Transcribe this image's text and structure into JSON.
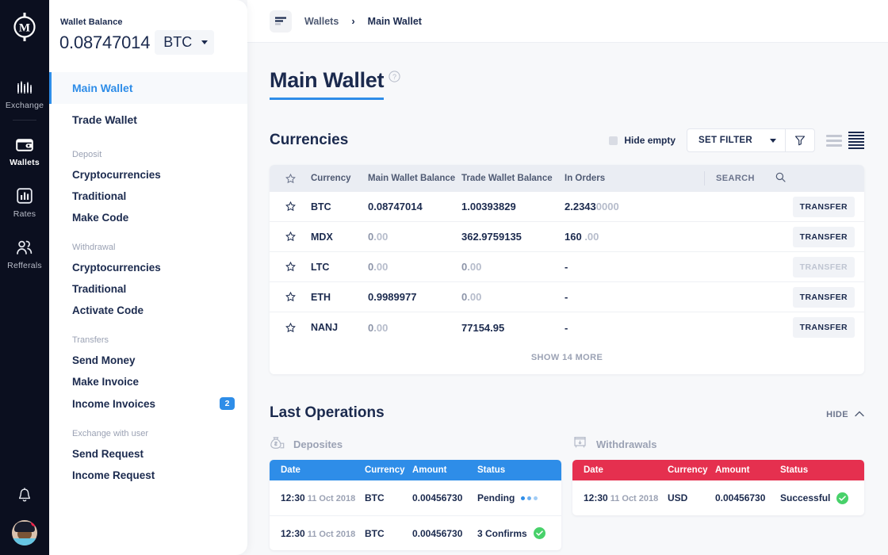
{
  "rail": {
    "logo_icon": "m-emblem-logo",
    "items": [
      {
        "label": "Exchange",
        "icon": "chart-bars-icon",
        "active": false
      },
      {
        "label": "Wallets",
        "icon": "wallet-icon",
        "active": true
      },
      {
        "label": "Rates",
        "icon": "bar-chart-square-icon",
        "active": false
      },
      {
        "label": "Refferals",
        "icon": "people-icon",
        "active": false
      }
    ],
    "bell_icon": "bell-icon",
    "avatar_alt": "user-avatar"
  },
  "panel": {
    "balance_label": "Wallet Balance",
    "balance_amount": "0.08747014",
    "balance_currency": "BTC",
    "nav_main": [
      {
        "label": "Main Wallet",
        "active": true
      },
      {
        "label": "Trade Wallet",
        "active": false
      }
    ],
    "groups": [
      {
        "title": "Deposit",
        "links": [
          {
            "label": "Cryptocurrencies",
            "badge": ""
          },
          {
            "label": "Traditional",
            "badge": ""
          },
          {
            "label": "Make Code",
            "badge": ""
          }
        ]
      },
      {
        "title": "Withdrawal",
        "links": [
          {
            "label": "Cryptocurrencies",
            "badge": ""
          },
          {
            "label": "Traditional",
            "badge": ""
          },
          {
            "label": "Activate Code",
            "badge": ""
          }
        ]
      },
      {
        "title": "Transfers",
        "links": [
          {
            "label": "Send Money",
            "badge": ""
          },
          {
            "label": "Make Invoice",
            "badge": ""
          },
          {
            "label": "Income Invoices",
            "badge": "2"
          }
        ]
      },
      {
        "title": "Exchange with user",
        "links": [
          {
            "label": "Send Request",
            "badge": ""
          },
          {
            "label": "Income Request",
            "badge": ""
          }
        ]
      }
    ]
  },
  "topbar": {
    "menu_icon": "hamburger-menu-icon",
    "breadcrumb": [
      "Wallets",
      "Main Wallet"
    ],
    "separator": "›"
  },
  "page": {
    "title": "Main Wallet",
    "help_icon": "question-circle-icon"
  },
  "currencies": {
    "section_title": "Currencies",
    "hide_empty_label": "Hide empty",
    "hide_empty_checked": false,
    "set_filter_label": "SET FILTER",
    "funnel_icon": "filter-funnel-icon",
    "view_icons": [
      "list-view-icon",
      "compact-view-icon"
    ],
    "columns": [
      "Currency",
      "Main Wallet Balance",
      "Trade Wallet Balance",
      "In Orders"
    ],
    "star_icon": "star-outline-icon",
    "search_label": "SEARCH",
    "search_icon": "magnifier-icon",
    "rows": [
      {
        "currency": "BTC",
        "main": "0.08747014",
        "main_dim": "",
        "trade": "1.00393829",
        "trade_dim": "",
        "orders": "2.2343",
        "orders_dim": "0000",
        "action": "TRANSFER",
        "action_enabled": true
      },
      {
        "currency": "MDX",
        "main": "0",
        "main_dim": ".00",
        "trade": "362.9759135",
        "trade_dim": "",
        "orders": "160 ",
        "orders_dim": ".00",
        "action": "TRANSFER",
        "action_enabled": true
      },
      {
        "currency": "LTC",
        "main": "0",
        "main_dim": ".00",
        "trade": "0",
        "trade_dim": ".00",
        "orders": "-",
        "orders_dim": "",
        "action": "TRANSFER",
        "action_enabled": false
      },
      {
        "currency": "ETH",
        "main": "0.9989977",
        "main_dim": "",
        "trade": "0",
        "trade_dim": ".00",
        "orders": "-",
        "orders_dim": "",
        "action": "TRANSFER",
        "action_enabled": true
      },
      {
        "currency": "NANJ",
        "main": "0",
        "main_dim": ".00",
        "trade": "77154.95",
        "trade_dim": "",
        "orders": "-",
        "orders_dim": "",
        "action": "TRANSFER",
        "action_enabled": true
      }
    ],
    "show_more": "SHOW 14 MORE"
  },
  "operations": {
    "section_title": "Last Operations",
    "hide_label": "HIDE",
    "collapse_icon": "chevron-up-icon",
    "deposits": {
      "caption": "Deposites",
      "icon": "money-bag-icon",
      "columns": [
        "Date",
        "Currency",
        "Amount",
        "Status"
      ],
      "rows": [
        {
          "time": "12:30",
          "date": "11 Oct 2018",
          "currency": "BTC",
          "amount": "0.00456730",
          "status": "Pending",
          "status_icon": "dots-loading-icon"
        },
        {
          "time": "12:30",
          "date": "11 Oct 2018",
          "currency": "BTC",
          "amount": "0.00456730",
          "status": "3 Confirms",
          "status_icon": "check-circle-icon"
        }
      ]
    },
    "withdrawals": {
      "caption": "Withdrawals",
      "icon": "atm-withdraw-icon",
      "columns": [
        "Date",
        "Currency",
        "Amount",
        "Status"
      ],
      "rows": [
        {
          "time": "12:30",
          "date": "11 Oct 2018",
          "currency": "USD",
          "amount": "0.00456730",
          "status": "Successful",
          "status_icon": "check-circle-icon"
        }
      ]
    }
  },
  "colors": {
    "accent_blue": "#2e8de8",
    "accent_red": "#e5304f",
    "rail_dark": "#0b0f1f",
    "text_navy": "#1b2a4e",
    "success_green": "#48d16a"
  }
}
